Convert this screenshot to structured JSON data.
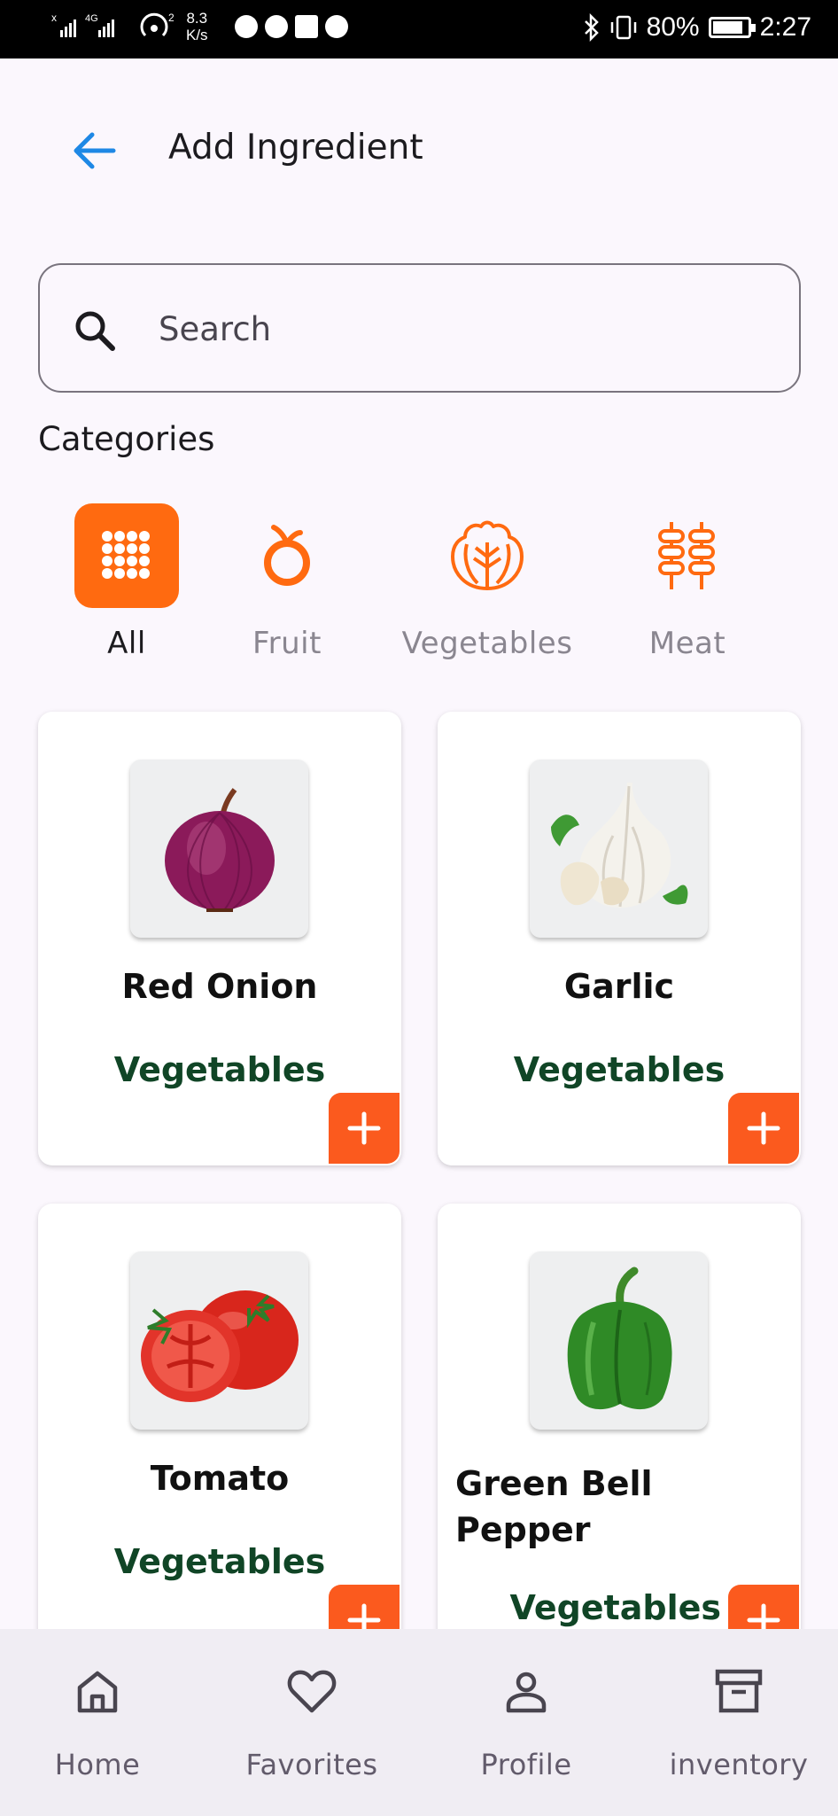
{
  "status_bar": {
    "net_speed_value": "8.3",
    "net_speed_unit": "K/s",
    "battery": "80%",
    "battery_level": 0.8,
    "time": "2:27"
  },
  "header": {
    "title": "Add Ingredient",
    "back_icon": "arrow-left-icon"
  },
  "search": {
    "placeholder": "Search",
    "value": ""
  },
  "categories_title": "Categories",
  "categories": [
    {
      "label": "All",
      "icon": "grid-icon",
      "selected": true
    },
    {
      "label": "Fruit",
      "icon": "orange-fruit-icon",
      "selected": false
    },
    {
      "label": "Vegetables",
      "icon": "lettuce-icon",
      "selected": false
    },
    {
      "label": "Meat",
      "icon": "kebab-skewer-icon",
      "selected": false
    }
  ],
  "products": [
    {
      "name": "Red Onion",
      "category": "Vegetables",
      "image": "red-onion-image"
    },
    {
      "name": "Garlic",
      "category": "Vegetables",
      "image": "garlic-image"
    },
    {
      "name": "Tomato",
      "category": "Vegetables",
      "image": "tomato-image"
    },
    {
      "name": "Green Bell Pepper",
      "category": "Vegetables",
      "image": "green-bell-pepper-image"
    }
  ],
  "bottom_nav": [
    {
      "label": "Home",
      "icon": "home-icon"
    },
    {
      "label": "Favorites",
      "icon": "heart-icon"
    },
    {
      "label": "Profile",
      "icon": "person-icon"
    },
    {
      "label": "inventory",
      "icon": "archive-box-icon"
    }
  ],
  "colors": {
    "accent": "#ff6a10",
    "add_button": "#fb5a1e",
    "category_text": "#104526",
    "back_arrow": "#1e88e5",
    "background": "#fbf7fd",
    "nav_background": "#f0edf3"
  }
}
